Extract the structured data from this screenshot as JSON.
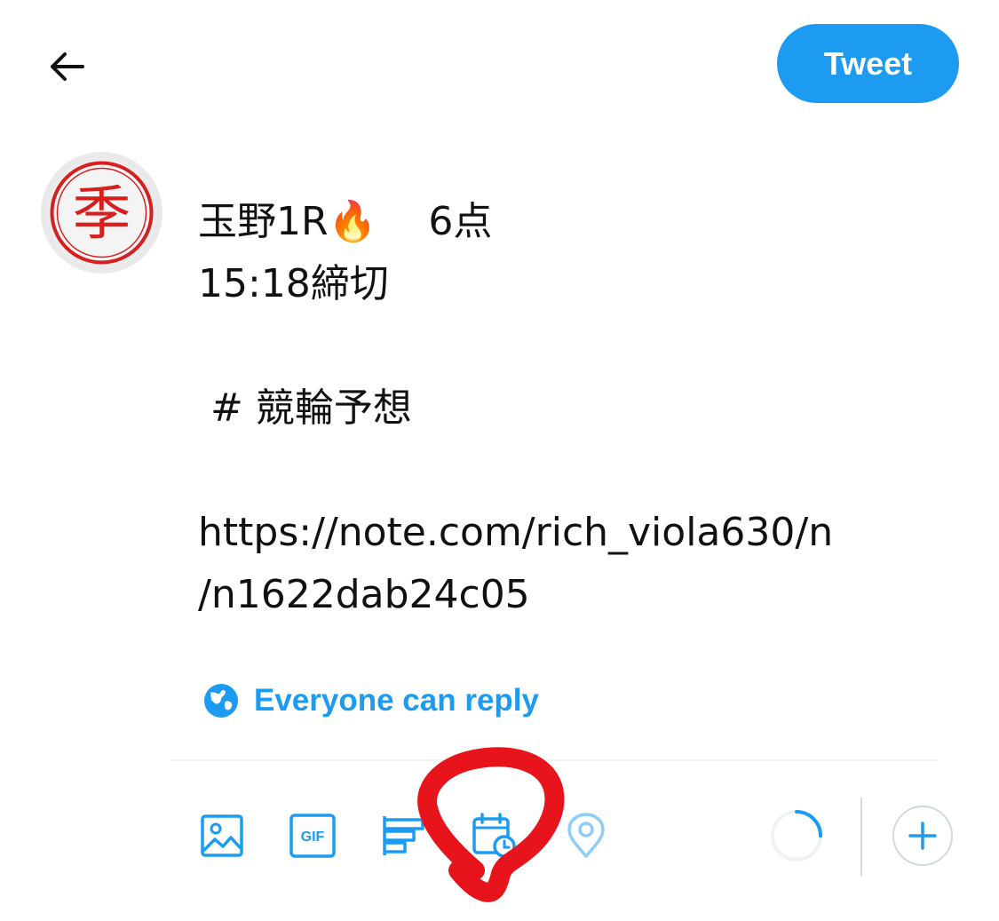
{
  "header": {
    "back_icon": "arrow-left-icon",
    "tweet_button_label": "Tweet"
  },
  "avatar": {
    "glyph": "季",
    "description_icon": "red-seal-stamp"
  },
  "compose": {
    "lines": [
      "玉野1R🔥　 6点",
      "15:18締切",
      "",
      " # 競輪予想",
      "",
      "https://note.com/rich_viola630/n",
      "/n1622dab24c05"
    ]
  },
  "reply_setting": {
    "icon": "globe-icon",
    "label": "Everyone can reply"
  },
  "toolbar": {
    "items": [
      {
        "name": "media-button",
        "icon": "image-icon"
      },
      {
        "name": "gif-button",
        "icon": "gif-icon",
        "label": "GIF"
      },
      {
        "name": "poll-button",
        "icon": "poll-icon"
      },
      {
        "name": "schedule-button",
        "icon": "calendar-clock-icon"
      },
      {
        "name": "location-button",
        "icon": "location-pin-icon"
      }
    ],
    "character_progress": 0.25,
    "add_icon": "plus-icon"
  },
  "colors": {
    "accent": "#1d9bf0",
    "disabled_accent": "#8ecdf7",
    "annotation": "#e8141b",
    "text": "#111111"
  }
}
